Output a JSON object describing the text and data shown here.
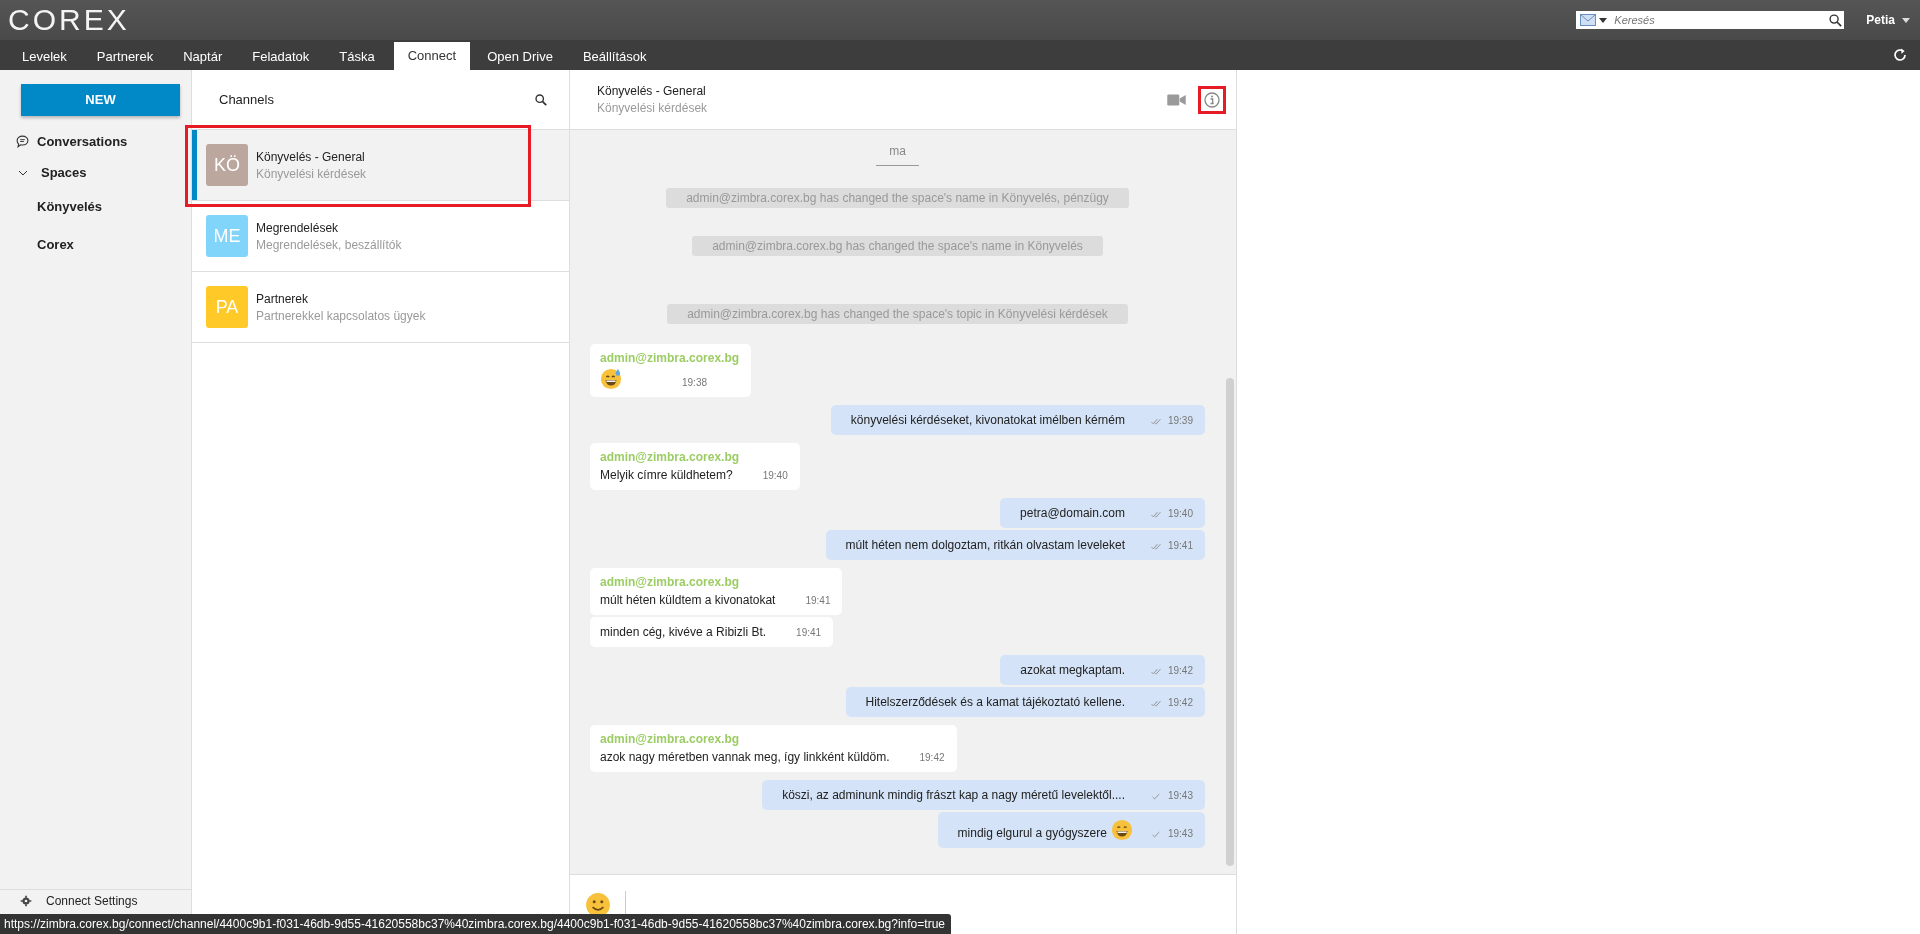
{
  "app_header": {
    "logo": "COREX",
    "search": {
      "placeholder": "Keresés"
    },
    "user": "Petia"
  },
  "tabs": [
    {
      "label": "Levelek",
      "selected": false
    },
    {
      "label": "Partnerek",
      "selected": false
    },
    {
      "label": "Naptár",
      "selected": false
    },
    {
      "label": "Feladatok",
      "selected": false
    },
    {
      "label": "Táska",
      "selected": false
    },
    {
      "label": "Connect",
      "selected": true
    },
    {
      "label": "Open Drive",
      "selected": false
    },
    {
      "label": "Beállítások",
      "selected": false
    }
  ],
  "sidebar": {
    "new_button": "NEW",
    "items": [
      {
        "label": "Conversations",
        "kind": "link"
      },
      {
        "label": "Spaces",
        "kind": "group",
        "expanded": true,
        "children": [
          {
            "label": "Könyvelés"
          },
          {
            "label": "Corex"
          }
        ]
      }
    ],
    "settings": "Connect Settings"
  },
  "channels": {
    "title": "Channels",
    "items": [
      {
        "initials": "KÖ",
        "name": "Könyvelés - General",
        "topic": "Könyvelési kérdések",
        "color": "#bca79f",
        "selected": true,
        "highlighted": true
      },
      {
        "initials": "ME",
        "name": "Megrendelések",
        "topic": "Megrendelések, beszállítók",
        "color": "#81d4fa",
        "selected": false,
        "highlighted": false
      },
      {
        "initials": "PA",
        "name": "Partnerek",
        "topic": "Partnerekkel kapcsolatos ügyek",
        "color": "#ffca28",
        "selected": false,
        "highlighted": false
      }
    ]
  },
  "chat": {
    "title": "Könyvelés - General",
    "topic": "Könyvelési kérdések",
    "info_highlighted": true,
    "messages": [
      {
        "kind": "date",
        "text": "ma"
      },
      {
        "kind": "system",
        "text": "admin@zimbra.corex.bg has changed the space's name in Könyvelés, pénzügy"
      },
      {
        "kind": "system",
        "text": "admin@zimbra.corex.bg has changed the space's name in Könyvelés"
      },
      {
        "kind": "system",
        "text": "admin@zimbra.corex.bg has changed the space's topic in Könyvelési kérdések"
      },
      {
        "kind": "incoming",
        "sender": "admin@zimbra.corex.bg",
        "emoji": true,
        "sweat_drop": true,
        "time": "19:38"
      },
      {
        "kind": "outgoing",
        "text": "könyvelési kérdéseket, kivonatokat imélben kérném",
        "time": "19:39",
        "read": true
      },
      {
        "kind": "incoming",
        "sender": "admin@zimbra.corex.bg",
        "text": "Melyik címre küldhetem?",
        "time": "19:40"
      },
      {
        "kind": "outgoing",
        "text": "petra@domain.com",
        "time": "19:40",
        "read": true
      },
      {
        "kind": "outgoing",
        "text": "múlt héten nem dolgoztam, ritkán olvastam leveleket",
        "time": "19:41",
        "read": true
      },
      {
        "kind": "incoming",
        "sender": "admin@zimbra.corex.bg",
        "text": "múlt héten küldtem a kivonatokat",
        "time": "19:41"
      },
      {
        "kind": "incoming",
        "text": "minden cég, kivéve a Ribizli Bt.",
        "time": "19:41"
      },
      {
        "kind": "outgoing",
        "text": "azokat megkaptam.",
        "time": "19:42",
        "read": true
      },
      {
        "kind": "outgoing",
        "text": "Hitelszerződések és a kamat tájékoztató kellene.",
        "time": "19:42",
        "read": true
      },
      {
        "kind": "incoming",
        "sender": "admin@zimbra.corex.bg",
        "text": "azok nagy méretben vannak meg, így linkként küldöm.",
        "time": "19:42"
      },
      {
        "kind": "outgoing",
        "text": "köszi, az adminunk mindig frászt kap a nagy méretű levelektől....",
        "time": "19:43",
        "read": false
      },
      {
        "kind": "outgoing",
        "text": "mindig elgurul a gyógyszere",
        "emoji": true,
        "sweat_drop": false,
        "time": "19:43",
        "read": false
      }
    ]
  },
  "status_bar": "https://zimbra.corex.bg/connect/channel/4400c9b1-f031-46db-9d55-41620558bc37%40zimbra.corex.bg/4400c9b1-f031-46db-9d55-41620558bc37%40zimbra.corex.bg?info=true"
}
